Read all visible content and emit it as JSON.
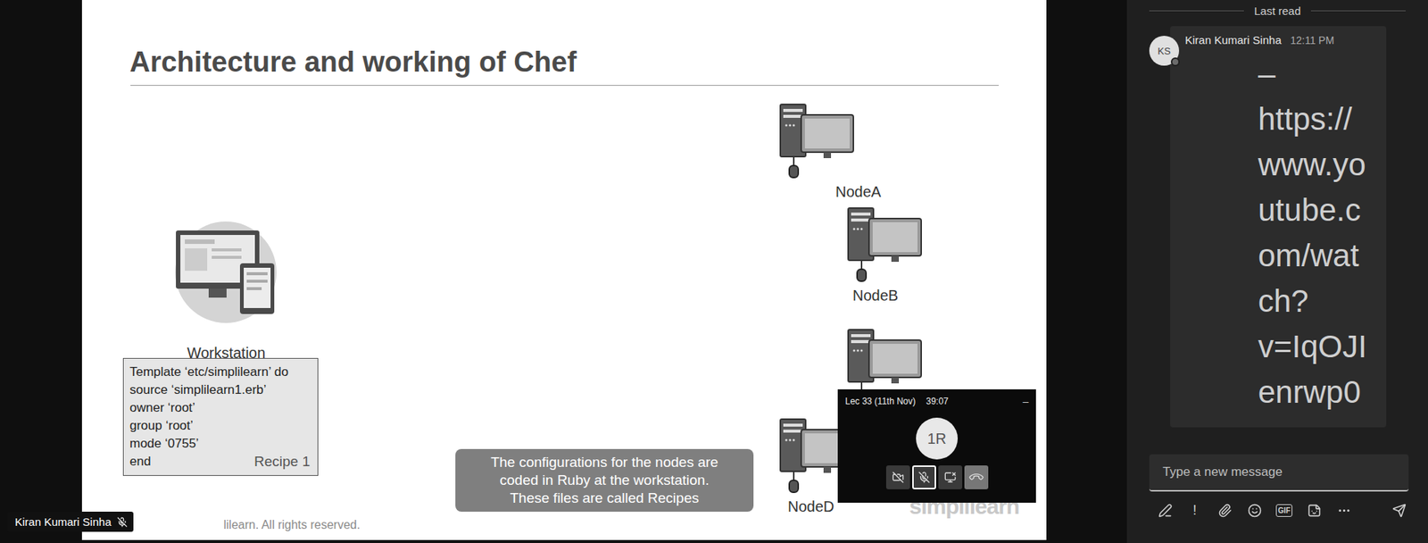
{
  "slide": {
    "title": "Architecture and working of Chef",
    "workstation": {
      "label": "Workstation"
    },
    "recipe": {
      "lines": [
        "Template ‘etc/simplilearn’ do",
        "source ‘simplilearn1.erb’",
        "owner ‘root’",
        "group ‘root’",
        "mode ‘0755’",
        "end"
      ],
      "label": "Recipe 1"
    },
    "nodes": [
      {
        "label": "NodeA"
      },
      {
        "label": "NodeB"
      },
      {
        "label": ""
      },
      {
        "label": "NodeD"
      }
    ],
    "caption": [
      "The configurations for the nodes are",
      "coded in Ruby at the workstation.",
      "These files are called Recipes"
    ],
    "footer": "lilearn. All rights reserved.",
    "logo": "simplilearn"
  },
  "call_popup": {
    "title": "Lec 33 (11th Nov)",
    "duration": "39:07",
    "minimize": "–",
    "avatar": "1R",
    "controls": [
      {
        "kind": "video-off",
        "selected": false
      },
      {
        "kind": "mic",
        "selected": true
      },
      {
        "kind": "share",
        "selected": false
      },
      {
        "kind": "hangup",
        "selected": false
      }
    ]
  },
  "presenter_badge": {
    "name": "Kiran Kumari Sinha",
    "muted": true
  },
  "chat": {
    "divider": "Last read",
    "messages": [
      {
        "initials": "KS",
        "author": "Kiran Kumari Sinha",
        "time": "12:11 PM",
        "lines": [
          "–",
          "https://",
          "www.yo",
          "utube.c",
          "om/wat",
          "ch?",
          "v=IqOJI",
          "enrwp0"
        ]
      }
    ],
    "compose": {
      "placeholder": "Type a new message"
    },
    "toolbar": [
      {
        "kind": "format",
        "glyph": ""
      },
      {
        "kind": "priority",
        "glyph": "!"
      },
      {
        "kind": "attach",
        "glyph": ""
      },
      {
        "kind": "emoji",
        "glyph": ""
      },
      {
        "kind": "gif",
        "glyph": "GIF"
      },
      {
        "kind": "sticker",
        "glyph": ""
      },
      {
        "kind": "more",
        "glyph": ""
      },
      {
        "kind": "send",
        "glyph": ""
      }
    ]
  }
}
